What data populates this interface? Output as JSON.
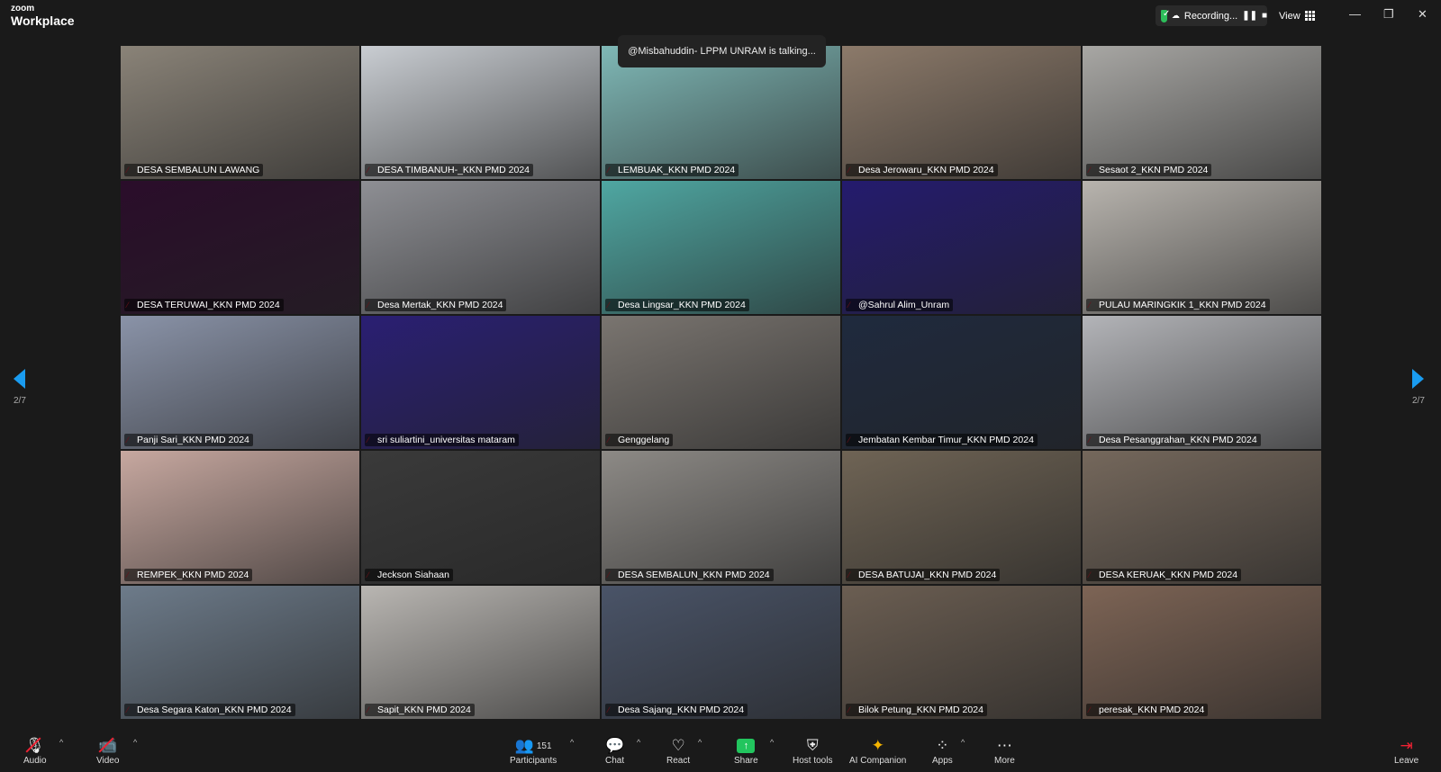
{
  "app": {
    "brand_small": "zoom",
    "brand_name": "Workplace"
  },
  "header": {
    "recording_label": "Recording...",
    "view_label": "View"
  },
  "talking_banner": "@Misbahuddin- LPPM UNRAM is talking...",
  "pagination": {
    "left": "2/7",
    "right": "2/7"
  },
  "tiles": [
    {
      "name": "DESA SEMBALUN LAWANG",
      "bg": "#8a8378"
    },
    {
      "name": "DESA TIMBANUH-_KKN PMD 2024",
      "bg": "#c9cdd2"
    },
    {
      "name": "LEMBUAK_KKN PMD 2024",
      "bg": "#7fb8b6"
    },
    {
      "name": "Desa Jerowaru_KKN PMD 2024",
      "bg": "#8c7a6a"
    },
    {
      "name": "Sesaot 2_KKN PMD 2024",
      "bg": "#a8a7a4"
    },
    {
      "name": "DESA TERUWAI_KKN PMD 2024",
      "bg": "#2a0d2a"
    },
    {
      "name": "Desa Mertak_KKN PMD 2024",
      "bg": "#8e8f94"
    },
    {
      "name": "Desa Lingsar_KKN PMD 2024",
      "bg": "#4fa7a2"
    },
    {
      "name": "@Sahrul Alim_Unram",
      "bg": "#241b6e"
    },
    {
      "name": "PULAU MARINGKIK 1_KKN PMD 2024",
      "bg": "#b8b4ae"
    },
    {
      "name": "Panji Sari_KKN PMD 2024",
      "bg": "#8a93a8"
    },
    {
      "name": "sri suliartini_universitas mataram",
      "bg": "#2a1f73"
    },
    {
      "name": "Genggelang",
      "bg": "#7a7570"
    },
    {
      "name": "Jembatan Kembar Timur_KKN PMD 2024",
      "bg": "#1f2a3e"
    },
    {
      "name": "Desa Pesanggrahan_KKN PMD 2024",
      "bg": "#b3b4b8"
    },
    {
      "name": "REMPEK_KKN PMD 2024",
      "bg": "#c7a8a0"
    },
    {
      "name": "Jeckson Siahaan",
      "bg": "#3a3a3a"
    },
    {
      "name": "DESA SEMBALUN_KKN PMD 2024",
      "bg": "#8d8a86"
    },
    {
      "name": "DESA BATUJAI_KKN PMD 2024",
      "bg": "#6f6455"
    },
    {
      "name": "DESA KERUAK_KKN PMD 2024",
      "bg": "#75685c"
    },
    {
      "name": "Desa Segara Katon_KKN PMD 2024",
      "bg": "#6d7b8a"
    },
    {
      "name": "Sapit_KKN PMD 2024",
      "bg": "#b9b6b2"
    },
    {
      "name": "Desa Sajang_KKN PMD 2024",
      "bg": "#4a5468"
    },
    {
      "name": "Bilok Petung_KKN PMD 2024",
      "bg": "#6b5e52"
    },
    {
      "name": "peresak_KKN PMD 2024",
      "bg": "#7d6455"
    }
  ],
  "toolbar": {
    "audio": "Audio",
    "video": "Video",
    "participants": "Participants",
    "participants_count": "151",
    "chat": "Chat",
    "react": "React",
    "share": "Share",
    "host_tools": "Host tools",
    "ai_companion": "AI Companion",
    "apps": "Apps",
    "more": "More",
    "leave": "Leave"
  },
  "colors": {
    "accent": "#1a9cf0",
    "share": "#22c55e",
    "muted": "#e23"
  }
}
